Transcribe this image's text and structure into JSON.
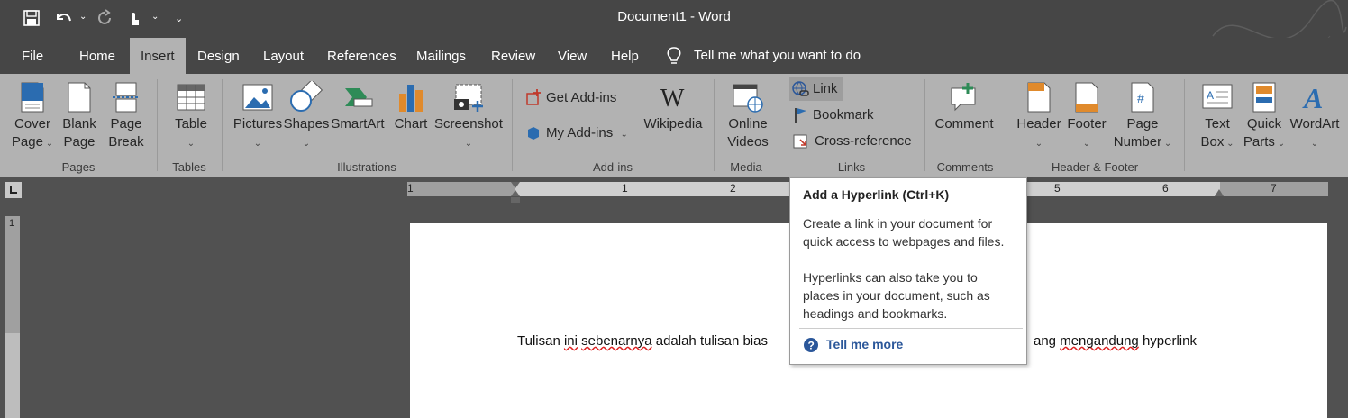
{
  "window": {
    "title": "Document1  -  Word"
  },
  "qat": {
    "more": "⌄"
  },
  "tabs": [
    {
      "label": "File"
    },
    {
      "label": "Home"
    },
    {
      "label": "Insert"
    },
    {
      "label": "Design"
    },
    {
      "label": "Layout"
    },
    {
      "label": "References"
    },
    {
      "label": "Mailings"
    },
    {
      "label": "Review"
    },
    {
      "label": "View"
    },
    {
      "label": "Help"
    }
  ],
  "tellme": "Tell me what you want to do",
  "ribbon": {
    "pages": {
      "cover_page_1": "Cover",
      "cover_page_2": "Page",
      "blank_page_1": "Blank",
      "blank_page_2": "Page",
      "page_break_1": "Page",
      "page_break_2": "Break",
      "label": "Pages"
    },
    "tables": {
      "table": "Table",
      "label": "Tables"
    },
    "illustrations": {
      "pictures": "Pictures",
      "shapes": "Shapes",
      "smartart": "SmartArt",
      "chart": "Chart",
      "screenshot": "Screenshot",
      "label": "Illustrations"
    },
    "addins": {
      "get": "Get Add-ins",
      "my": "My Add-ins",
      "wikipedia": "Wikipedia",
      "label": "Add-ins"
    },
    "media": {
      "online_1": "Online",
      "online_2": "Videos",
      "label": "Media"
    },
    "links": {
      "link": "Link",
      "bookmark": "Bookmark",
      "crossref": "Cross-reference",
      "label": "Links"
    },
    "comments": {
      "comment": "Comment",
      "label": "Comments"
    },
    "header_footer": {
      "header": "Header",
      "footer": "Footer",
      "page_number_1": "Page",
      "page_number_2": "Number",
      "label": "Header & Footer"
    },
    "text": {
      "textbox_1": "Text",
      "textbox_2": "Box",
      "quickparts_1": "Quick",
      "quickparts_2": "Parts",
      "wordart": "WordArt"
    }
  },
  "ruler": {
    "numbers": [
      "1",
      "1",
      "2",
      "5",
      "6",
      "7"
    ],
    "vertical_number": "1"
  },
  "document": {
    "text_start": "Tulisan ",
    "w_ini": "ini",
    "mid1": " ",
    "w_sebenarnya": "sebenarnya",
    "mid2": " adalah tulisan bias",
    "right_part_1": "ang ",
    "w_mengandung": "mengandung",
    "right_part_2": " hyperlink"
  },
  "tooltip": {
    "title": "Add a Hyperlink (Ctrl+K)",
    "body1": "Create a link in your document for quick access to webpages and files.",
    "body2": "Hyperlinks can also take you to places in your document, such as headings and bookmarks.",
    "more": "Tell me more"
  },
  "colors": {
    "accent": "#2b579a",
    "ribbon": "#b2b2b2",
    "titlebar": "#464646"
  }
}
